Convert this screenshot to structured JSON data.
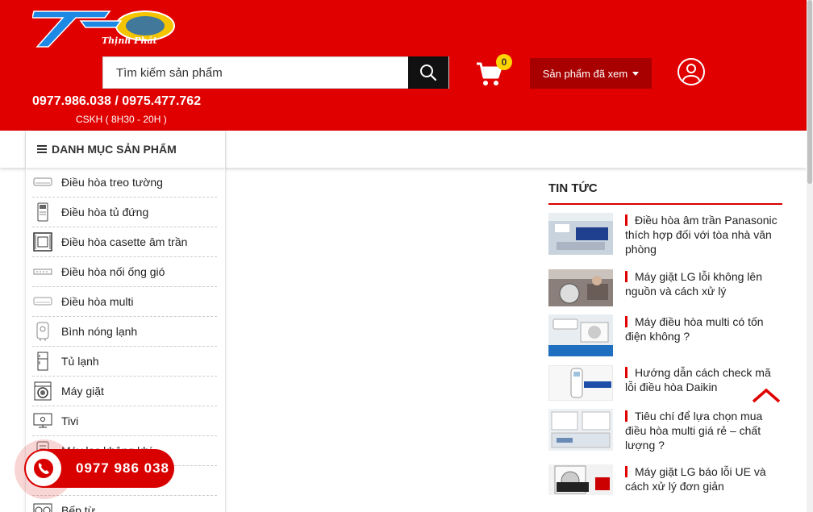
{
  "header": {
    "logo_text": "Thịnh Phát",
    "search_placeholder": "Tìm kiếm sản phẩm",
    "cart_count": "0",
    "viewed_products_label": "Sản phẩm đã xem",
    "hotline": "0977.986.038 / 0975.477.762",
    "cskh": "CSKH ( 8H30 - 20H )"
  },
  "categories": {
    "title": "DANH MỤC SẢN PHẨM",
    "items": [
      {
        "label": "Điều hòa treo tường",
        "icon": "wall-ac-icon"
      },
      {
        "label": "Điều hòa tủ đứng",
        "icon": "floor-ac-icon"
      },
      {
        "label": "Điều hòa casette âm trần",
        "icon": "cassette-ac-icon"
      },
      {
        "label": "Điều hòa nối ống gió",
        "icon": "duct-ac-icon"
      },
      {
        "label": "Điều hòa multi",
        "icon": "multi-ac-icon"
      },
      {
        "label": "Bình nóng lạnh",
        "icon": "water-heater-icon"
      },
      {
        "label": "Tủ lạnh",
        "icon": "fridge-icon"
      },
      {
        "label": "Máy giặt",
        "icon": "washing-machine-icon"
      },
      {
        "label": "Tivi",
        "icon": "tv-icon"
      },
      {
        "label": "Máy lọc không khí",
        "icon": "air-purifier-icon"
      },
      {
        "label": "",
        "icon": "blank-icon"
      },
      {
        "label": "Bếp từ",
        "icon": "induction-cooker-icon"
      }
    ]
  },
  "news": {
    "title": "TIN TỨC",
    "items": [
      {
        "title": "Điều hòa âm trần Panasonic thích hợp đối với tòa nhà văn phòng"
      },
      {
        "title": "Máy giặt LG lỗi không lên nguồn và cách xử lý"
      },
      {
        "title": "Máy điều hòa multi có tốn điện không ?"
      },
      {
        "title": "Hướng dẫn cách check mã lỗi điều hòa Daikin"
      },
      {
        "title": "Tiêu chí để lựa chọn mua điều hòa multi giá rẻ – chất lượng ?"
      },
      {
        "title": "Máy giặt LG báo lỗi UE và cách xử lý đơn giản"
      }
    ]
  },
  "floating": {
    "phone": "0977 986 038"
  },
  "colors": {
    "brand_red": "#e00000",
    "dark_red": "#a80000",
    "badge_yellow": "#ffd400"
  }
}
